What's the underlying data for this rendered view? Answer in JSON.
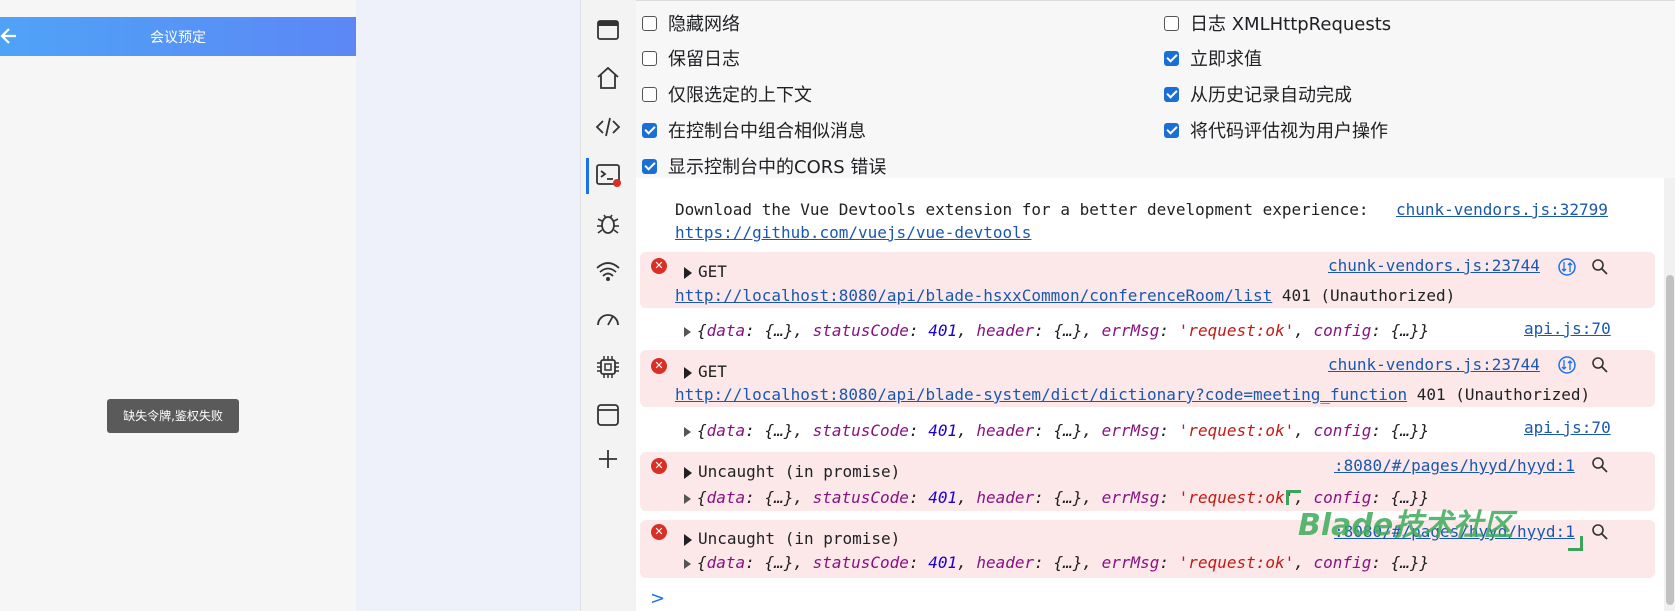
{
  "preview": {
    "title": "会议预定",
    "toast": "缺失令牌,鉴权失败"
  },
  "activity_bar": {
    "icons": [
      "window-icon",
      "home-icon",
      "code-icon",
      "console-icon",
      "bug-icon",
      "wifi-icon",
      "performance-icon",
      "chip-icon",
      "panel-icon",
      "plus-icon"
    ]
  },
  "settings": {
    "left": [
      {
        "label": "隐藏网络",
        "checked": false
      },
      {
        "label": "保留日志",
        "checked": false
      },
      {
        "label": "仅限选定的上下文",
        "checked": false
      },
      {
        "label": "在控制台中组合相似消息",
        "checked": true
      },
      {
        "label": "显示控制台中的CORS 错误",
        "checked": true
      }
    ],
    "right": [
      {
        "label": "日志 XMLHttpRequests",
        "checked": false
      },
      {
        "label": "立即求值",
        "checked": true
      },
      {
        "label": "从历史记录自动完成",
        "checked": true
      },
      {
        "label": "将代码评估视为用户操作",
        "checked": true
      }
    ]
  },
  "console": {
    "vue_msg": "Download the Vue Devtools extension for a better development experience:",
    "vue_src": "chunk-vendors.js:32799",
    "vue_link": "https://github.com/vuejs/vue-devtools",
    "err1": {
      "method": "GET",
      "src": "chunk-vendors.js:23744",
      "url": "http://localhost:8080/api/blade-hsxxCommon/conferenceRoom/list",
      "status": "401 (Unauthorized)"
    },
    "obj_src1": "api.js:70",
    "err2": {
      "method": "GET",
      "src": "chunk-vendors.js:23744",
      "url": "http://localhost:8080/api/blade-system/dict/dictionary?code=meeting_function",
      "status": "401 (Unauthorized)"
    },
    "obj_src2": "api.js:70",
    "err3": {
      "text": "Uncaught (in promise)",
      "src": ":8080/#/pages/hyyd/hyyd:1"
    },
    "err4": {
      "text": "Uncaught (in promise)",
      "src": ":8080/#/pages/hyyd/hyyd:1"
    },
    "obj": {
      "open": "{",
      "k1": "data",
      "v1": "{…}",
      "k2": "statusCode",
      "v2": "401",
      "k3": "header",
      "v3": "{…}",
      "k4": "errMsg",
      "v4": "'request:ok'",
      "k5": "config",
      "v5": "{…}",
      "close": "}"
    },
    "prompt": ">"
  },
  "watermark": "Blade技术社区"
}
